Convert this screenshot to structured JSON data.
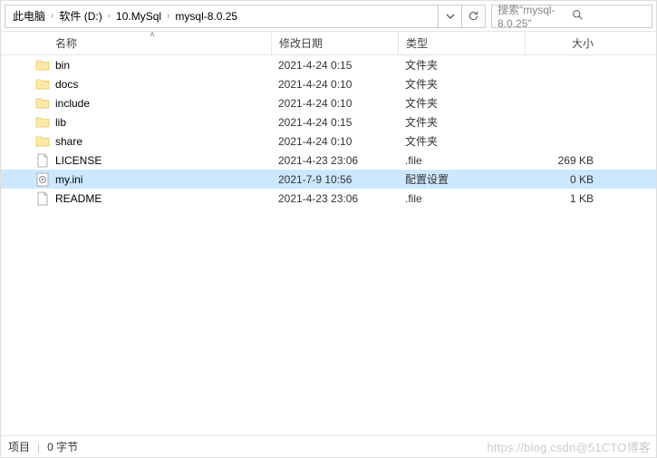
{
  "breadcrumb": [
    "此电脑",
    "软件 (D:)",
    "10.MySql",
    "mysql-8.0.25"
  ],
  "search": {
    "placeholder": "搜索\"mysql-8.0.25\""
  },
  "columns": {
    "name": "名称",
    "date": "修改日期",
    "type": "类型",
    "size": "大小"
  },
  "rows": [
    {
      "icon": "folder",
      "name": "bin",
      "date": "2021-4-24 0:15",
      "type": "文件夹",
      "size": "",
      "selected": false
    },
    {
      "icon": "folder",
      "name": "docs",
      "date": "2021-4-24 0:10",
      "type": "文件夹",
      "size": "",
      "selected": false
    },
    {
      "icon": "folder",
      "name": "include",
      "date": "2021-4-24 0:10",
      "type": "文件夹",
      "size": "",
      "selected": false
    },
    {
      "icon": "folder",
      "name": "lib",
      "date": "2021-4-24 0:15",
      "type": "文件夹",
      "size": "",
      "selected": false
    },
    {
      "icon": "folder",
      "name": "share",
      "date": "2021-4-24 0:10",
      "type": "文件夹",
      "size": "",
      "selected": false
    },
    {
      "icon": "file",
      "name": "LICENSE",
      "date": "2021-4-23 23:06",
      "type": ".file",
      "size": "269 KB",
      "selected": false
    },
    {
      "icon": "ini",
      "name": "my.ini",
      "date": "2021-7-9 10:56",
      "type": "配置设置",
      "size": "0 KB",
      "selected": true
    },
    {
      "icon": "file",
      "name": "README",
      "date": "2021-4-23 23:06",
      "type": ".file",
      "size": "1 KB",
      "selected": false
    }
  ],
  "status": {
    "items": "项目",
    "selection": "0 字节"
  },
  "watermark": "https://blog.csdn@51CTO博客"
}
